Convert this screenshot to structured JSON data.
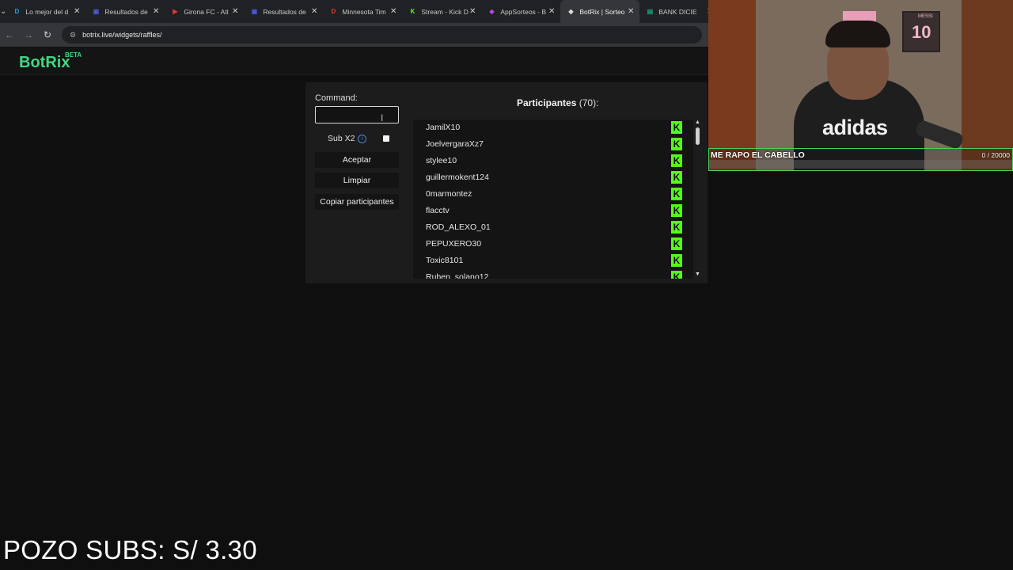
{
  "browser": {
    "tabs": [
      {
        "title": "Lo mejor del d",
        "icon": "D",
        "color": "#1da1f2",
        "active": false
      },
      {
        "title": "Resultados de",
        "icon": "▣",
        "color": "#4a5bd6",
        "active": false
      },
      {
        "title": "Girona FC - Atl",
        "icon": "▶",
        "color": "#e53935",
        "active": false
      },
      {
        "title": "Resultados de",
        "icon": "▣",
        "color": "#4a5bd6",
        "active": false
      },
      {
        "title": "Minnesota Tim",
        "icon": "D",
        "color": "#e53935",
        "active": false
      },
      {
        "title": "Stream - Kick D",
        "icon": "K",
        "color": "#53fc18",
        "active": false
      },
      {
        "title": "AppSorteos - B",
        "icon": "◆",
        "color": "#b04bd6",
        "active": false
      },
      {
        "title": "BotRix | Sorteo",
        "icon": "◆",
        "color": "#dddddd",
        "active": true
      },
      {
        "title": "BANK DICIE",
        "icon": "▤",
        "color": "#1aa37a",
        "active": false
      }
    ],
    "url": "botrix.live/widgets/raffles/"
  },
  "header": {
    "logo": "BotRix",
    "beta": "BETA"
  },
  "widget": {
    "command_label": "Command:",
    "command_value": "",
    "sub_x2_label": "Sub X2",
    "sub_x2_checked": false,
    "accept_label": "Aceptar",
    "clear_label": "Limpiar",
    "copy_label": "Copiar participantes",
    "participants_title": "Participantes",
    "participants_count": "(70):",
    "participants": [
      "JamilX10",
      "JoelvergaraXz7",
      "stylee10",
      "guillermokent124",
      "0marmontez",
      "flacctv",
      "ROD_ALEXO_01",
      "PEPUXERO30",
      "Toxic8101",
      "Ruben_solano12"
    ],
    "platform_icon": "kick-icon",
    "platform_color": "#53fc18"
  },
  "overlay": {
    "goal_title": "ME RAPO EL CABELLO",
    "goal_count": "0 / 20000",
    "goal_progress": 0,
    "shirt_text": "adidas",
    "frame_text": "MESSI",
    "frame_number": "10",
    "pozo_text": "POZO SUBS: S/ 3.30"
  }
}
